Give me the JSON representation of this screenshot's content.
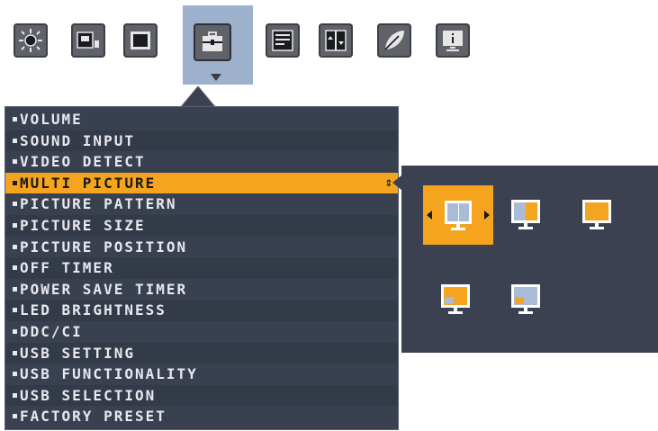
{
  "tabs": [
    {
      "icon": "brightness-sun-icon"
    },
    {
      "icon": "display-input-icon"
    },
    {
      "icon": "screen-frame-icon"
    },
    {
      "icon": "toolbox-icon",
      "selected": true
    },
    {
      "icon": "osd-settings-icon"
    },
    {
      "icon": "split-screen-icon"
    },
    {
      "icon": "eco-leaf-icon"
    },
    {
      "icon": "monitor-info-icon"
    }
  ],
  "menu": {
    "items": [
      {
        "label": "VOLUME"
      },
      {
        "label": "SOUND INPUT"
      },
      {
        "label": "VIDEO DETECT"
      },
      {
        "label": "MULTI PICTURE",
        "active": true
      },
      {
        "label": "PICTURE PATTERN"
      },
      {
        "label": "PICTURE SIZE"
      },
      {
        "label": "PICTURE POSITION"
      },
      {
        "label": "OFF TIMER"
      },
      {
        "label": "POWER SAVE TIMER"
      },
      {
        "label": "LED BRIGHTNESS"
      },
      {
        "label": "DDC/CI"
      },
      {
        "label": "USB SETTING"
      },
      {
        "label": "USB FUNCTIONALITY"
      },
      {
        "label": "USB SELECTION"
      },
      {
        "label": "FACTORY PRESET"
      }
    ],
    "updown_glyph": "⇕"
  },
  "submenu": {
    "patterns": [
      {
        "name": "side-by-side",
        "selected": true
      },
      {
        "name": "split-left-blue"
      },
      {
        "name": "full-single"
      },
      {
        "name": "pip-bottom-left"
      },
      {
        "name": "pip-bottom-left-small"
      }
    ]
  },
  "colors": {
    "accent": "#f5a41f",
    "menu_bg": "#3b4150",
    "tab_selected_bg": "#9eb1cc",
    "screen_blue": "#aabbd8"
  }
}
